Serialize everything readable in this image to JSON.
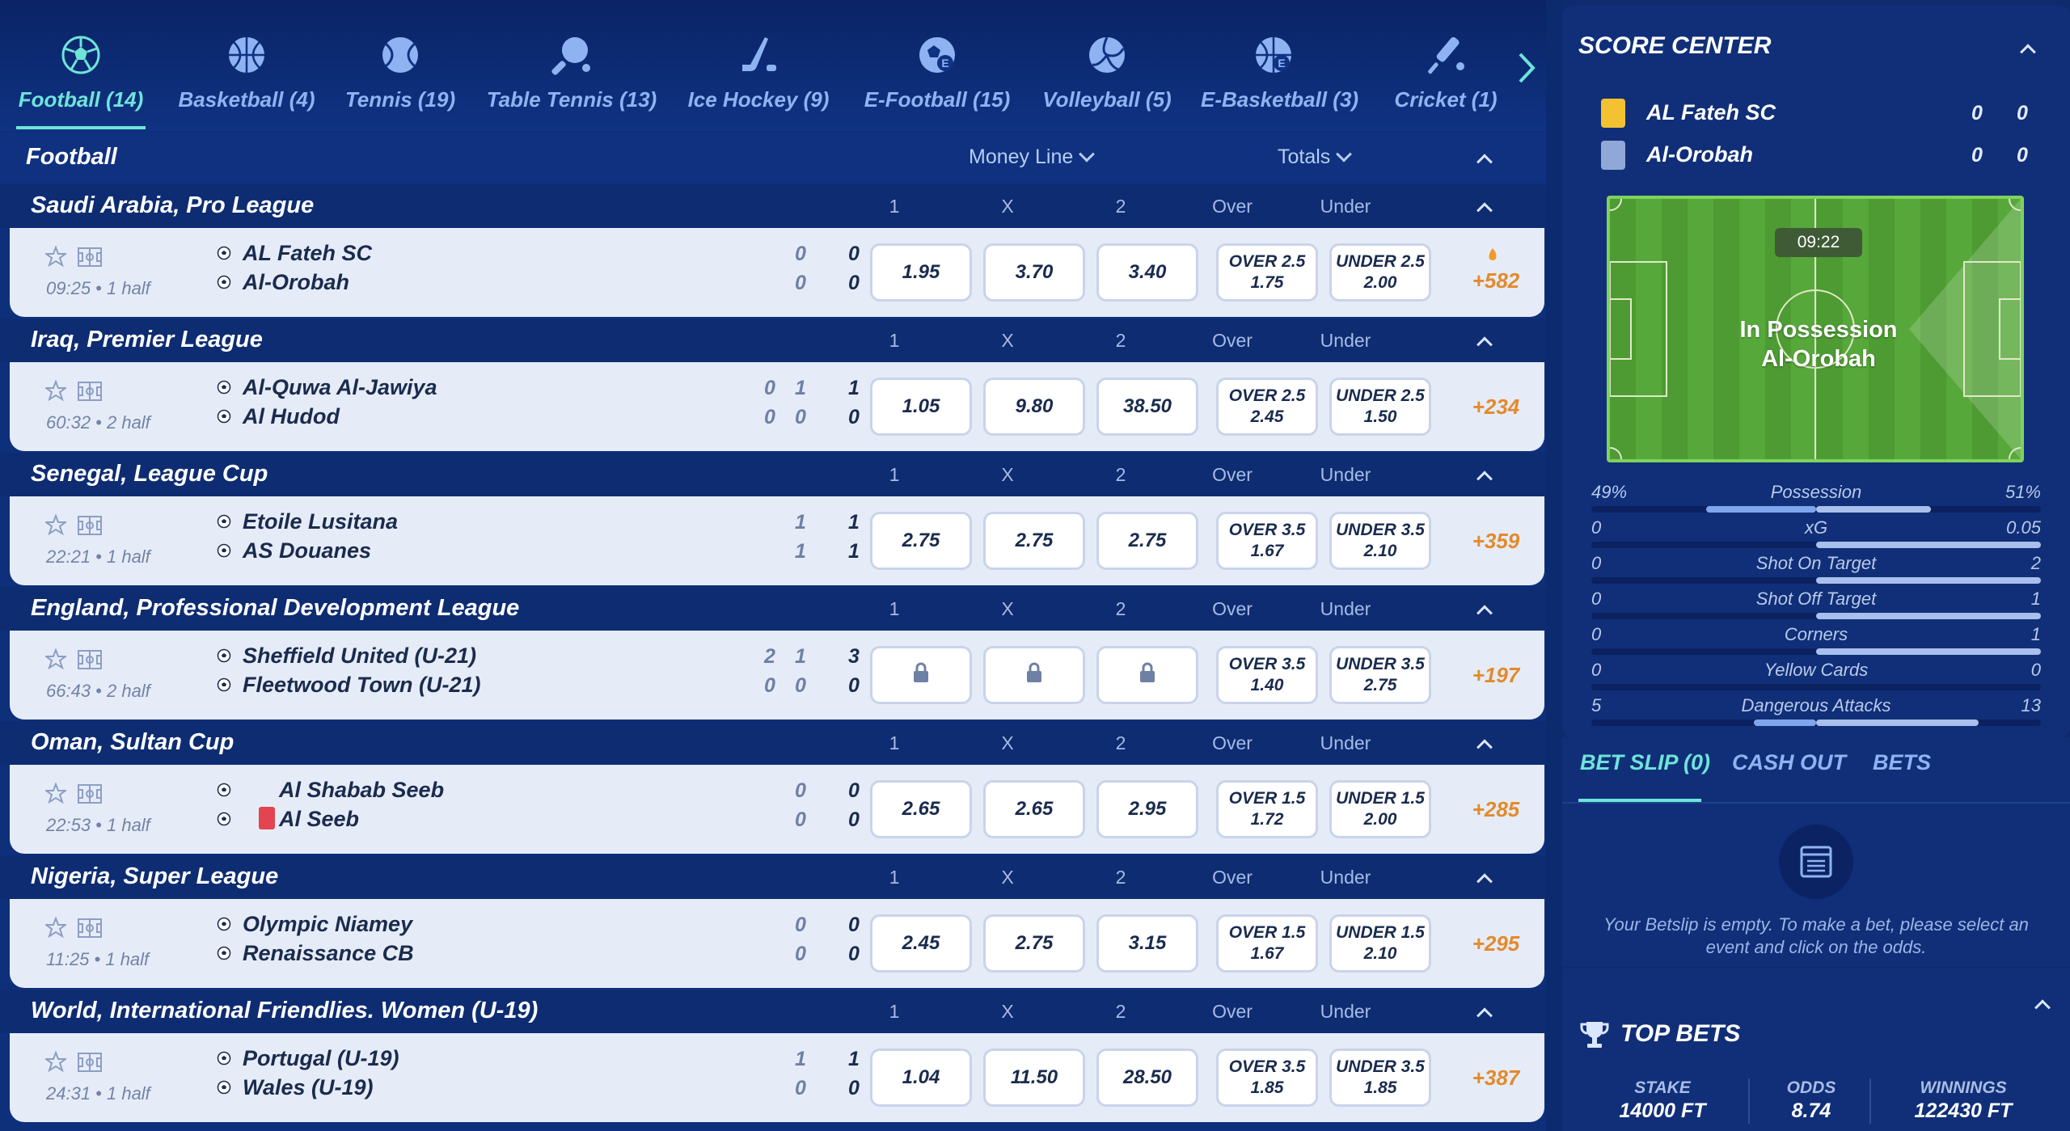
{
  "sports": [
    {
      "label": "Football (14)",
      "icon": "soccer-ball-icon",
      "active": true
    },
    {
      "label": "Basketball (4)",
      "icon": "basketball-icon"
    },
    {
      "label": "Tennis (19)",
      "icon": "tennis-ball-icon"
    },
    {
      "label": "Table Tennis (13)",
      "icon": "table-tennis-icon"
    },
    {
      "label": "Ice Hockey (9)",
      "icon": "ice-hockey-icon"
    },
    {
      "label": "E-Football (15)",
      "icon": "e-football-icon"
    },
    {
      "label": "Volleyball (5)",
      "icon": "volleyball-icon"
    },
    {
      "label": "E-Basketball (3)",
      "icon": "e-basketball-icon"
    },
    {
      "label": "Cricket (1)",
      "icon": "cricket-icon"
    }
  ],
  "header": {
    "title": "Football",
    "money_line": "Money Line",
    "totals": "Totals"
  },
  "columns": {
    "c1": "1",
    "cx": "X",
    "c2": "2",
    "over": "Over",
    "under": "Under"
  },
  "leagues": [
    {
      "name": "Saudi Arabia, Pro League",
      "time": "09:25 • 1 half",
      "team1": "AL Fateh SC",
      "team2": "Al-Orobah",
      "scores1": [
        "",
        "0",
        "0"
      ],
      "scores2": [
        "",
        "0",
        "0"
      ],
      "odds": [
        "1.95",
        "3.70",
        "3.40"
      ],
      "over": {
        "label": "OVER 2.5",
        "value": "1.75"
      },
      "under": {
        "label": "UNDER 2.5",
        "value": "2.00"
      },
      "more": "+582",
      "hot": true
    },
    {
      "name": "Iraq, Premier League",
      "time": "60:32 • 2 half",
      "team1": "Al-Quwa Al-Jawiya",
      "team2": "Al Hudod",
      "scores1": [
        "0",
        "1",
        "1"
      ],
      "scores2": [
        "0",
        "0",
        "0"
      ],
      "odds": [
        "1.05",
        "9.80",
        "38.50"
      ],
      "over": {
        "label": "OVER 2.5",
        "value": "2.45"
      },
      "under": {
        "label": "UNDER 2.5",
        "value": "1.50"
      },
      "more": "+234"
    },
    {
      "name": "Senegal, League Cup",
      "time": "22:21 • 1 half",
      "team1": "Etoile Lusitana",
      "team2": "AS Douanes",
      "scores1": [
        "",
        "1",
        "1"
      ],
      "scores2": [
        "",
        "1",
        "1"
      ],
      "odds": [
        "2.75",
        "2.75",
        "2.75"
      ],
      "over": {
        "label": "OVER 3.5",
        "value": "1.67"
      },
      "under": {
        "label": "UNDER 3.5",
        "value": "2.10"
      },
      "more": "+359"
    },
    {
      "name": "England, Professional Development League",
      "time": "66:43 • 2 half",
      "team1": "Sheffield United (U-21)",
      "team2": "Fleetwood Town (U-21)",
      "scores1": [
        "2",
        "1",
        "3"
      ],
      "scores2": [
        "0",
        "0",
        "0"
      ],
      "odds": [
        "",
        "",
        ""
      ],
      "locked": true,
      "over": {
        "label": "OVER 3.5",
        "value": "1.40"
      },
      "under": {
        "label": "UNDER 3.5",
        "value": "2.75"
      },
      "more": "+197"
    },
    {
      "name": "Oman, Sultan Cup",
      "time": "22:53 • 1 half",
      "team1": "Al Shabab Seeb",
      "team2": "Al Seeb",
      "scores1": [
        "",
        "0",
        "0"
      ],
      "scores2": [
        "",
        "0",
        "0"
      ],
      "odds": [
        "2.65",
        "2.65",
        "2.95"
      ],
      "over": {
        "label": "OVER 1.5",
        "value": "1.72"
      },
      "under": {
        "label": "UNDER 1.5",
        "value": "2.00"
      },
      "more": "+285",
      "redcard": true
    },
    {
      "name": "Nigeria, Super League",
      "time": "11:25 • 1 half",
      "team1": "Olympic Niamey",
      "team2": "Renaissance CB",
      "scores1": [
        "",
        "0",
        "0"
      ],
      "scores2": [
        "",
        "0",
        "0"
      ],
      "odds": [
        "2.45",
        "2.75",
        "3.15"
      ],
      "over": {
        "label": "OVER 1.5",
        "value": "1.67"
      },
      "under": {
        "label": "UNDER 1.5",
        "value": "2.10"
      },
      "more": "+295"
    },
    {
      "name": "World, International Friendlies. Women (U-19)",
      "time": "24:31 • 1 half",
      "team1": "Portugal (U-19)",
      "team2": "Wales (U-19)",
      "scores1": [
        "",
        "1",
        "1"
      ],
      "scores2": [
        "",
        "0",
        "0"
      ],
      "odds": [
        "1.04",
        "11.50",
        "28.50"
      ],
      "over": {
        "label": "OVER 3.5",
        "value": "1.85"
      },
      "under": {
        "label": "UNDER 3.5",
        "value": "1.85"
      },
      "more": "+387"
    }
  ],
  "score_center": {
    "title": "SCORE CENTER",
    "team1": {
      "name": "AL Fateh SC",
      "s1": "0",
      "s2": "0",
      "color": "#f2c230"
    },
    "team2": {
      "name": "Al-Orobah",
      "s1": "0",
      "s2": "0",
      "color": "#8fa8d8"
    },
    "clock": "09:22",
    "possession_text_1": "In Possession",
    "possession_text_2": "Al-Orobah",
    "stats": [
      {
        "name": "Possession",
        "left": "49%",
        "right": "51%",
        "lv": 49,
        "rv": 51
      },
      {
        "name": "xG",
        "left": "0",
        "right": "0.05",
        "lv": 0,
        "rv": 0.05
      },
      {
        "name": "Shot On Target",
        "left": "0",
        "right": "2",
        "lv": 0,
        "rv": 2
      },
      {
        "name": "Shot Off Target",
        "left": "0",
        "right": "1",
        "lv": 0,
        "rv": 1
      },
      {
        "name": "Corners",
        "left": "0",
        "right": "1",
        "lv": 0,
        "rv": 1
      },
      {
        "name": "Yellow Cards",
        "left": "0",
        "right": "0",
        "lv": 0,
        "rv": 0
      },
      {
        "name": "Dangerous Attacks",
        "left": "5",
        "right": "13",
        "lv": 5,
        "rv": 13
      }
    ]
  },
  "betslip": {
    "tab1": "BET SLIP (0)",
    "tab2": "CASH OUT",
    "tab3": "BETS",
    "empty": "Your Betslip is empty. To make a bet, please select an event and click on the odds."
  },
  "top_bets": {
    "title": "TOP BETS",
    "stake_label": "STAKE",
    "stake": "14000 FT",
    "odds_label": "ODDS",
    "odds": "8.74",
    "winnings_label": "WINNINGS",
    "winnings": "122430 FT"
  },
  "colors": {
    "accent": "#6ee4d8",
    "more": "#e38a2b",
    "background": "#0e2f7a"
  }
}
